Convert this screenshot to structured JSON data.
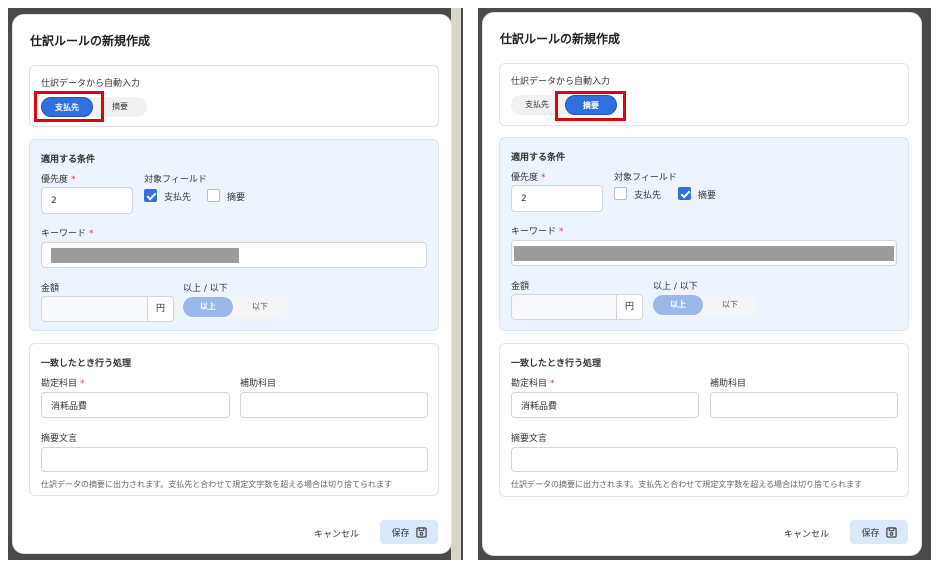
{
  "dialog": {
    "title": "仕訳ルールの新規作成",
    "auto_input": {
      "heading": "仕訳データから自動入力",
      "options": [
        "支払先",
        "摘要"
      ]
    },
    "conditions": {
      "heading": "適用する条件",
      "priority_label": "優先度",
      "priority_value": "2",
      "target_field_label": "対象フィールド",
      "target_fields": [
        "支払先",
        "摘要"
      ],
      "keyword_label": "キーワード",
      "amount_label": "金額",
      "amount_unit": "円",
      "compare_label": "以上 / 以下",
      "compare_options": [
        "以上",
        "以下"
      ]
    },
    "actions": {
      "heading": "一致したとき行う処理",
      "account_label": "勘定科目",
      "account_value": "消耗品費",
      "sub_account_label": "補助科目",
      "memo_label": "摘要文言",
      "memo_help": "仕訳データの摘要に出力されます。支払先と合わせて規定文字数を超える場合は切り捨てられます"
    },
    "required_mark": "*",
    "cancel_label": "キャンセル",
    "save_label": "保存"
  },
  "panels": [
    {
      "selected_auto_input": "支払先",
      "checked_field": "支払先"
    },
    {
      "selected_auto_input": "摘要",
      "checked_field": "摘要"
    }
  ],
  "colors": {
    "accent": "#2f6fdf",
    "highlight": "#e3000f",
    "conditions_bg": "#eef4fe",
    "save_bg": "#dbe7fb"
  }
}
